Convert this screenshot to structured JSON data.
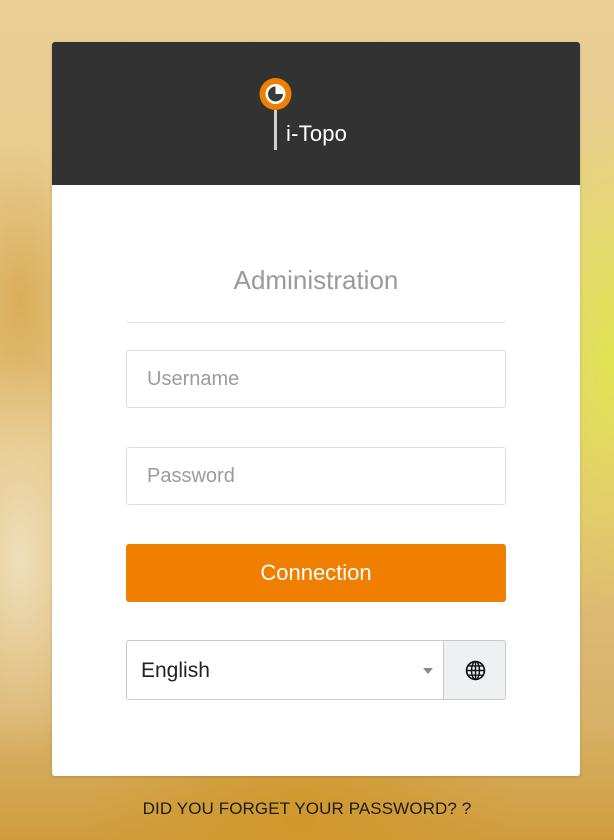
{
  "app": {
    "logo_text": "i-Topo"
  },
  "login": {
    "title": "Administration",
    "username": {
      "value": "",
      "placeholder": "Username"
    },
    "password": {
      "value": "",
      "placeholder": "Password"
    },
    "connect_label": "Connection",
    "language": {
      "selected": "English",
      "icon": "globe-icon"
    },
    "forgot_password_label": "DID YOU FORGET YOUR PASSWORD? ?"
  },
  "colors": {
    "header_bg": "#323232",
    "accent": "#f07f00",
    "card_bg": "#ffffff"
  }
}
